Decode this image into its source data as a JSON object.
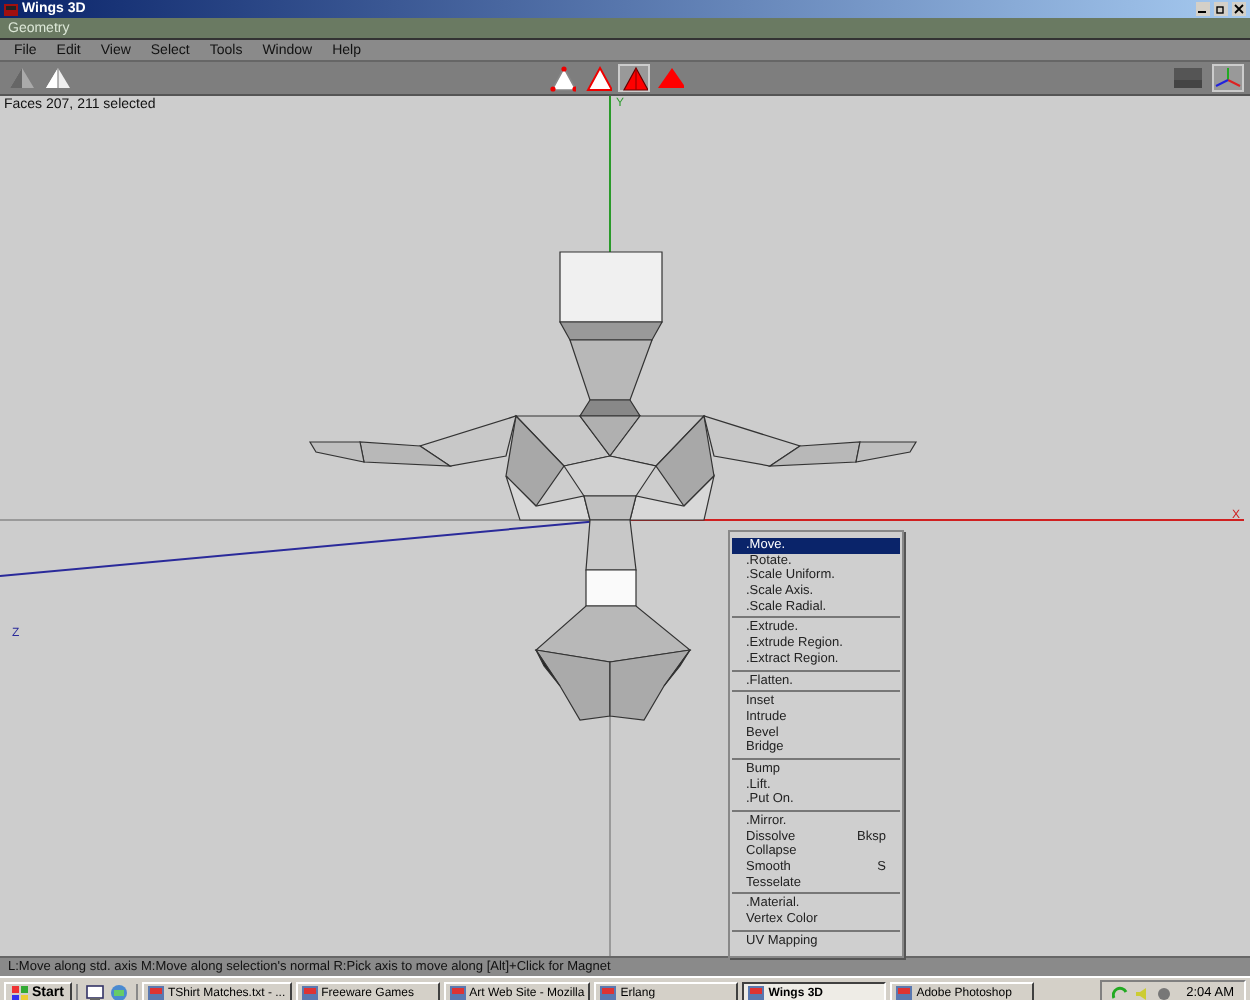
{
  "window": {
    "title": "Wings 3D"
  },
  "geometry_window": {
    "title": "Geometry"
  },
  "menu_bar": [
    "File",
    "Edit",
    "View",
    "Select",
    "Tools",
    "Window",
    "Help"
  ],
  "selection_modes": [
    {
      "kind": "vertex",
      "selected": false
    },
    {
      "kind": "edge",
      "selected": false
    },
    {
      "kind": "face",
      "selected": true
    },
    {
      "kind": "body",
      "selected": false
    }
  ],
  "viewport": {
    "info": "Faces 207, 211 selected",
    "y_axis_label": "Y",
    "x_axis_label": "X",
    "z_axis_label": "Z"
  },
  "context_menu": {
    "groups": [
      {
        "items": [
          {
            "label": ".Move.",
            "selected": true
          },
          {
            "label": ".Rotate.",
            "selected": false
          },
          {
            "label": ".Scale Uniform.",
            "selected": false
          },
          {
            "label": ".Scale Axis.",
            "selected": false
          },
          {
            "label": ".Scale Radial.",
            "selected": false
          }
        ]
      },
      {
        "items": [
          {
            "label": ".Extrude.",
            "selected": false
          },
          {
            "label": ".Extrude Region.",
            "selected": false
          },
          {
            "label": ".Extract Region.",
            "selected": false
          }
        ]
      },
      {
        "items": [
          {
            "label": ".Flatten.",
            "selected": false
          }
        ]
      },
      {
        "items": [
          {
            "label": "Inset",
            "selected": false
          },
          {
            "label": "Intrude",
            "selected": false
          },
          {
            "label": "Bevel",
            "selected": false
          },
          {
            "label": "Bridge",
            "selected": false
          }
        ]
      },
      {
        "items": [
          {
            "label": "Bump",
            "selected": false
          },
          {
            "label": ".Lift.",
            "selected": false
          },
          {
            "label": ".Put On.",
            "selected": false
          }
        ]
      },
      {
        "items": [
          {
            "label": ".Mirror.",
            "selected": false
          },
          {
            "label": "Dissolve",
            "hotkey": "Bksp",
            "selected": false
          },
          {
            "label": "Collapse",
            "selected": false
          },
          {
            "label": "Smooth",
            "hotkey": "S",
            "selected": false
          },
          {
            "label": "Tesselate",
            "selected": false
          }
        ]
      },
      {
        "items": [
          {
            "label": ".Material.",
            "selected": false
          },
          {
            "label": "Vertex Color",
            "selected": false
          }
        ]
      },
      {
        "items": [
          {
            "label": "UV Mapping",
            "selected": false
          }
        ]
      }
    ]
  },
  "status_bar": "L:Move along std. axis   M:Move along selection's normal   R:Pick axis to move along   [Alt]+Click for Magnet",
  "taskbar": {
    "start": "Start",
    "tasks": [
      {
        "label": "TShirt Matches.txt - ...",
        "selected": false
      },
      {
        "label": "Freeware Games",
        "selected": false
      },
      {
        "label": "Art Web Site - Mozilla",
        "selected": false
      },
      {
        "label": "Erlang",
        "selected": false
      },
      {
        "label": "Wings 3D",
        "selected": true
      },
      {
        "label": "Adobe Photoshop",
        "selected": false
      }
    ],
    "clock": "2:04 AM"
  }
}
